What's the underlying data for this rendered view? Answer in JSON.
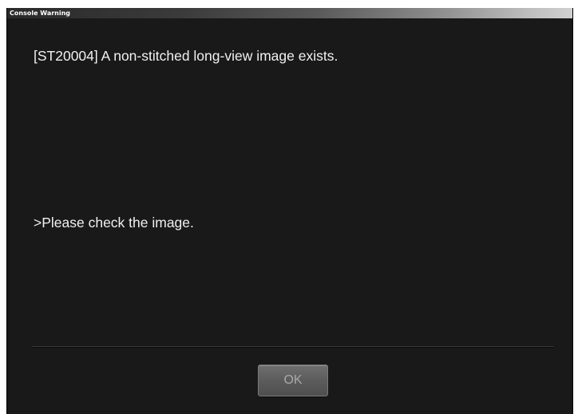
{
  "window": {
    "title": "Console Warning"
  },
  "message": {
    "main": "[ST20004] A non-stitched long-view image exists.",
    "sub": ">Please check the image."
  },
  "buttons": {
    "ok_label": "OK"
  }
}
